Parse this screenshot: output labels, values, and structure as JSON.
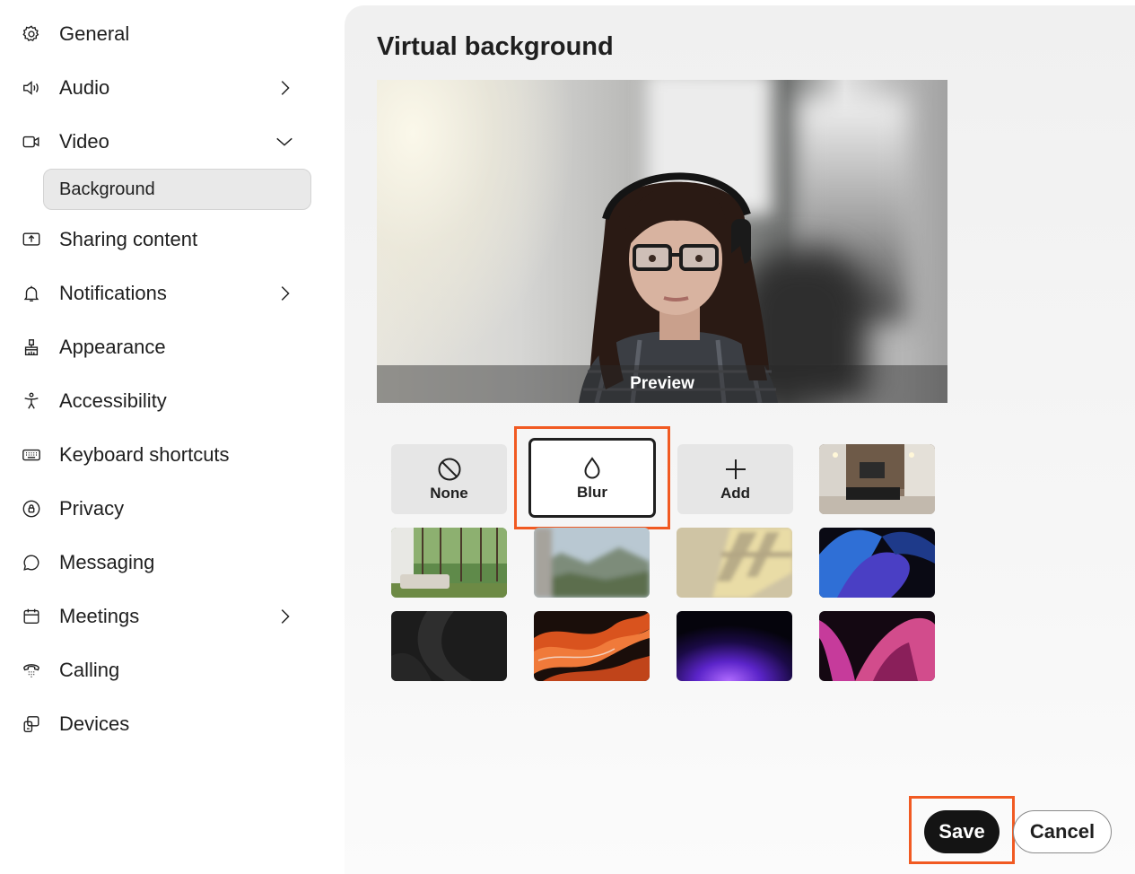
{
  "sidebar": {
    "items": [
      {
        "label": "General",
        "icon": "gear-icon"
      },
      {
        "label": "Audio",
        "icon": "speaker-icon",
        "chevron": "right"
      },
      {
        "label": "Video",
        "icon": "video-camera-icon",
        "chevron": "down"
      },
      {
        "label": "Sharing content",
        "icon": "share-screen-icon"
      },
      {
        "label": "Notifications",
        "icon": "bell-icon",
        "chevron": "right"
      },
      {
        "label": "Appearance",
        "icon": "paint-brush-icon"
      },
      {
        "label": "Accessibility",
        "icon": "accessibility-icon"
      },
      {
        "label": "Keyboard shortcuts",
        "icon": "keyboard-icon"
      },
      {
        "label": "Privacy",
        "icon": "privacy-icon"
      },
      {
        "label": "Messaging",
        "icon": "chat-bubble-icon"
      },
      {
        "label": "Meetings",
        "icon": "calendar-icon",
        "chevron": "right"
      },
      {
        "label": "Calling",
        "icon": "phone-icon"
      },
      {
        "label": "Devices",
        "icon": "devices-icon"
      }
    ],
    "sub_item": {
      "label": "Background",
      "parent": "Video",
      "selected": true
    }
  },
  "main": {
    "title": "Virtual background",
    "preview_label": "Preview",
    "options": [
      {
        "label": "None",
        "icon": "prohibited-icon"
      },
      {
        "label": "Blur",
        "icon": "droplet-icon",
        "selected": true
      },
      {
        "label": "Add",
        "icon": "plus-icon"
      }
    ],
    "backgrounds": [
      "office-interior",
      "living-room-forest",
      "blurred-mountains",
      "window-shadows",
      "blue-purple-waves",
      "dark-gray-curves",
      "orange-marble",
      "purple-glow",
      "pink-magenta-shapes"
    ]
  },
  "actions": {
    "save_label": "Save",
    "cancel_label": "Cancel"
  },
  "colors": {
    "highlight": "#f15a22",
    "save_bg": "#141414",
    "panel_bg": "#f0f0f0",
    "selected_nav_bg": "#e9e9e9"
  }
}
